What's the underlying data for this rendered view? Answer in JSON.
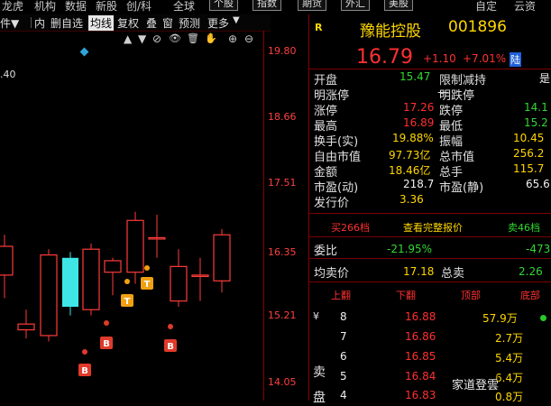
{
  "topnav": {
    "items": [
      "龙虎",
      "机构",
      "数据",
      "新股",
      "创/科",
      "全球"
    ],
    "buttons": [
      "个股",
      "指数",
      "期货",
      "外汇",
      "美股"
    ],
    "right": [
      "自定",
      "云资"
    ]
  },
  "toolbar": {
    "tabs": [
      "件▼",
      "内",
      "删自选",
      "均线",
      "复权",
      "叠",
      "窗",
      "预测",
      "更多"
    ],
    "active_tab": "均线"
  },
  "iconbar": {
    "icons": [
      "▲",
      "▼",
      "⊘",
      "👁",
      "🗑",
      "✋",
      "⊕",
      "⊖"
    ]
  },
  "chart": {
    "partial_label": ".40",
    "y_ticks": [
      "19.80",
      "18.66",
      "17.51",
      "16.35",
      "15.21",
      "14.05"
    ],
    "markers": [
      "B",
      "B",
      "B",
      "T",
      "T"
    ]
  },
  "chart_data": {
    "type": "candlestick",
    "ylim": [
      14.05,
      19.8
    ],
    "candles": [
      {
        "o": 15.9,
        "c": 16.4,
        "h": 16.6,
        "l": 15.5
      },
      {
        "o": 14.95,
        "c": 15.05,
        "h": 15.3,
        "l": 14.8
      },
      {
        "o": 14.85,
        "c": 16.25,
        "h": 16.35,
        "l": 14.75
      },
      {
        "o": 16.2,
        "c": 15.35,
        "h": 16.3,
        "l": 15.2
      },
      {
        "o": 15.3,
        "c": 16.35,
        "h": 16.45,
        "l": 15.2
      },
      {
        "o": 15.95,
        "c": 16.15,
        "h": 16.2,
        "l": 15.55
      },
      {
        "o": 15.95,
        "c": 16.85,
        "h": 17.0,
        "l": 15.75
      },
      {
        "o": 16.55,
        "c": 16.55,
        "h": 16.95,
        "l": 16.2
      },
      {
        "o": 15.45,
        "c": 16.05,
        "h": 16.35,
        "l": 15.35
      },
      {
        "o": 15.9,
        "c": 15.9,
        "h": 16.2,
        "l": 15.45
      },
      {
        "o": 15.8,
        "c": 16.6,
        "h": 16.7,
        "l": 15.6
      }
    ]
  },
  "quote": {
    "tag": "R",
    "name": "豫能控股",
    "code": "001896",
    "price": "16.79",
    "change": "+1.10",
    "change_pct": "+7.01%",
    "board": "陆",
    "stats_left": [
      {
        "label": "开盘",
        "value": "15.47"
      },
      {
        "label": "明涨停",
        "value": "—"
      },
      {
        "label": "涨停",
        "value": "17.26"
      },
      {
        "label": "最高",
        "value": "16.89"
      },
      {
        "label": "换手(实)",
        "value": "19.88%"
      },
      {
        "label": "自由市值",
        "value": "97.73亿"
      },
      {
        "label": "金额",
        "value": "18.46亿"
      },
      {
        "label": "市盈(动)",
        "value": "218.7"
      },
      {
        "label": "发行价",
        "value": "3.36"
      }
    ],
    "stats_right": [
      {
        "label": "限制减持",
        "value": "是"
      },
      {
        "label": "明跌停",
        "value": ""
      },
      {
        "label": "跌停",
        "value": "14.1"
      },
      {
        "label": "最低",
        "value": "15.2"
      },
      {
        "label": "振幅",
        "value": "10.45"
      },
      {
        "label": "总市值",
        "value": "256.2"
      },
      {
        "label": "总手",
        "value": "115.7"
      },
      {
        "label": "市盈(静)",
        "value": "65.6"
      }
    ],
    "order_bar": {
      "buy": "买266档",
      "full": "查看完整报价",
      "sell": "卖46档"
    },
    "weibi": {
      "label": "委比",
      "value": "-21.95%",
      "diff": "-473"
    },
    "avg_sell": {
      "label": "均卖价",
      "value": "17.18",
      "total_label": "总卖",
      "total": "2.26"
    },
    "ladder_headers": [
      "上翻",
      "下翻",
      "顶部",
      "底部"
    ],
    "side_labels": [
      "¥",
      "卖",
      "盘"
    ],
    "levels": [
      {
        "lvl": "8",
        "price": "16.88",
        "vol": "57.9万"
      },
      {
        "lvl": "7",
        "price": "16.86",
        "vol": "2.7万"
      },
      {
        "lvl": "6",
        "price": "16.85",
        "vol": "5.4万"
      },
      {
        "lvl": "5",
        "price": "16.84",
        "vol": "6.4万"
      },
      {
        "lvl": "4",
        "price": "16.83",
        "vol": "0.8万"
      }
    ],
    "watermark": "家道登雲"
  }
}
